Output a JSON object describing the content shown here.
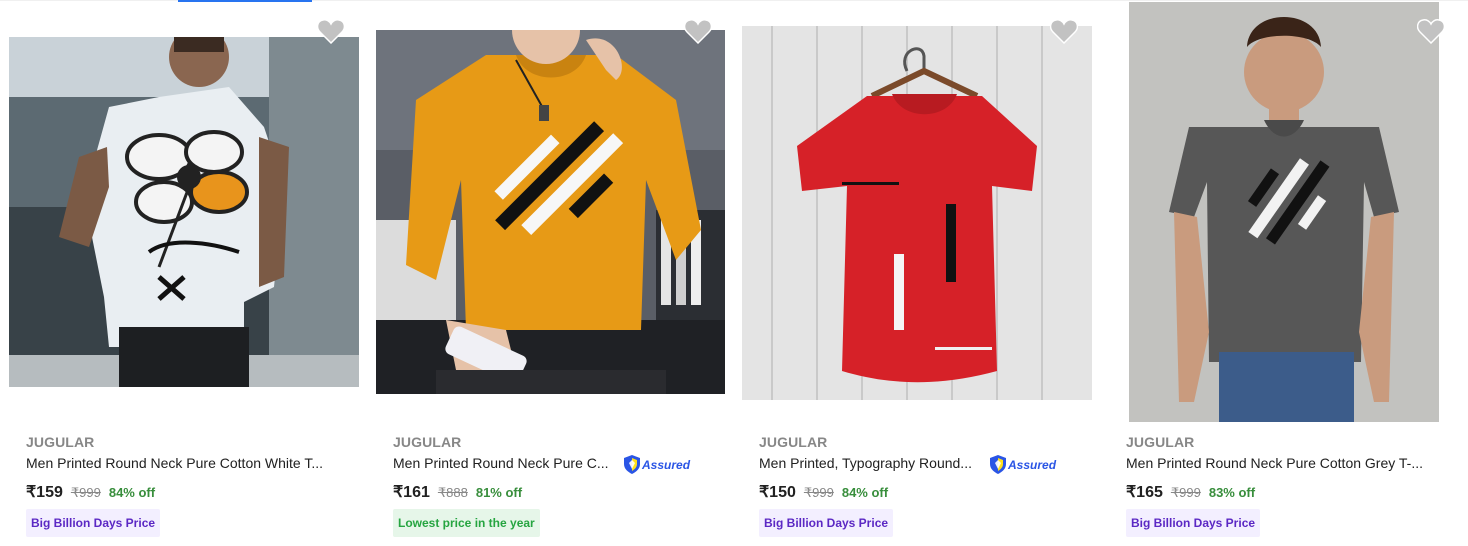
{
  "colors": {
    "accent": "#2874f0",
    "offer_green": "#388e3c",
    "assured_blue": "#2a55e5",
    "bbd_purple": "#5b28c4"
  },
  "assured_label": "Assured",
  "products": [
    {
      "brand": "JUGULAR",
      "title": "Men Printed Round Neck Pure Cotton White T...",
      "price": "₹159",
      "mrp": "₹999",
      "discount": "84% off",
      "badge": "Big Billion Days Price",
      "assured": false,
      "image": "white-floral-tshirt-model"
    },
    {
      "brand": "JUGULAR",
      "title": "Men Printed Round Neck Pure C...",
      "price": "₹161",
      "mrp": "₹888",
      "discount": "81% off",
      "badge": "Lowest price in the year",
      "assured": true,
      "image": "mustard-sweatshirt-model"
    },
    {
      "brand": "JUGULAR",
      "title": "Men Printed, Typography Round...",
      "price": "₹150",
      "mrp": "₹999",
      "discount": "84% off",
      "badge": "Big Billion Days Price",
      "assured": true,
      "image": "red-tshirt-on-hanger"
    },
    {
      "brand": "JUGULAR",
      "title": "Men Printed Round Neck Pure Cotton Grey T-...",
      "price": "₹165",
      "mrp": "₹999",
      "discount": "83% off",
      "badge": "Big Billion Days Price",
      "assured": false,
      "image": "grey-tshirt-model"
    }
  ]
}
